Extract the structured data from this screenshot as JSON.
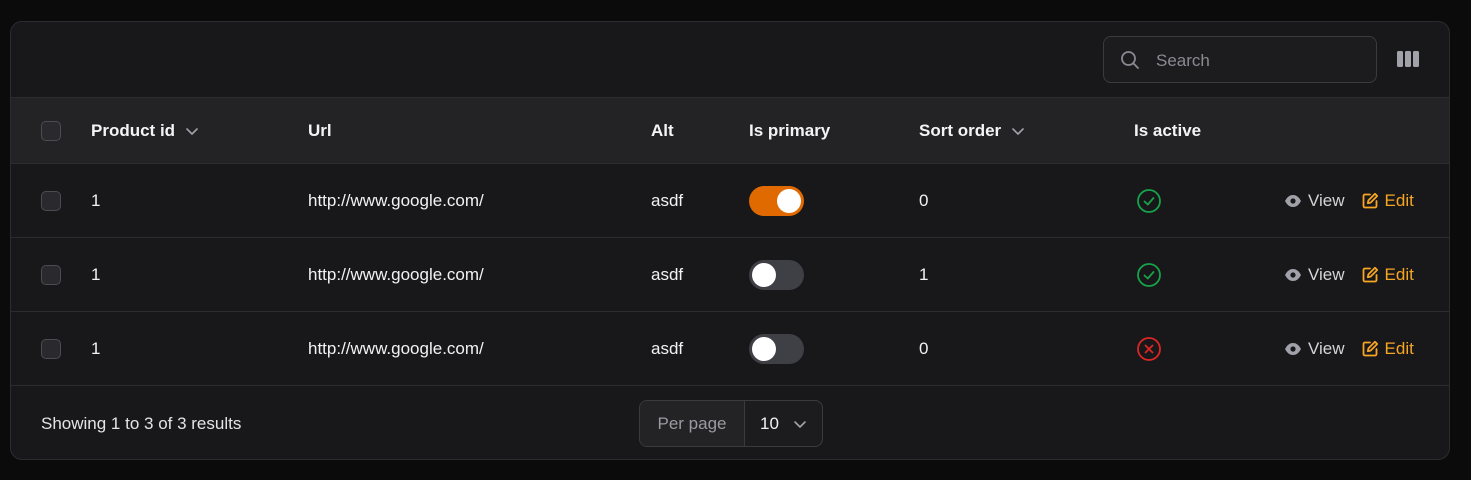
{
  "search": {
    "placeholder": "Search",
    "value": ""
  },
  "toolbar": {
    "columns_icon": "columns-icon"
  },
  "table": {
    "headers": {
      "product_id": "Product id",
      "url": "Url",
      "alt": "Alt",
      "is_primary": "Is primary",
      "sort_order": "Sort order",
      "is_active": "Is active"
    },
    "rows": [
      {
        "product_id": "1",
        "url": "http://www.google.com/",
        "alt": "asdf",
        "is_primary": true,
        "sort_order": "0",
        "is_active": true,
        "view_label": "View",
        "edit_label": "Edit"
      },
      {
        "product_id": "1",
        "url": "http://www.google.com/",
        "alt": "asdf",
        "is_primary": false,
        "sort_order": "1",
        "is_active": true,
        "view_label": "View",
        "edit_label": "Edit"
      },
      {
        "product_id": "1",
        "url": "http://www.google.com/",
        "alt": "asdf",
        "is_primary": false,
        "sort_order": "0",
        "is_active": false,
        "view_label": "View",
        "edit_label": "Edit"
      }
    ]
  },
  "footer": {
    "summary": "Showing 1 to 3 of 3 results",
    "per_page_label": "Per page",
    "per_page_value": "10"
  },
  "colors": {
    "accent": "#e06a00",
    "edit": "#f6a623",
    "success": "#16a34a",
    "danger": "#dc2626"
  }
}
